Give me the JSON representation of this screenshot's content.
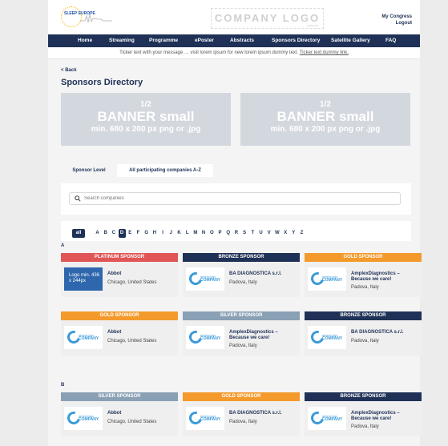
{
  "header": {
    "logo_text": "SLEEP EUROPE",
    "company_logo": "COMPANY LOGO",
    "company_logo_note": "optional",
    "account_links": [
      "My Congress",
      "Logout"
    ]
  },
  "nav": [
    "Home",
    "Streaming",
    "Programme",
    "ePoster",
    "Abstracts",
    "Sponsors Directory",
    "Satellite Gallery",
    "FAQ"
  ],
  "ticker": {
    "text": "Ticker text with your message … visit lorem ipsum  for new lorem ipsum dummy text.",
    "link": "Ticker text dummy link."
  },
  "back_label": "Back",
  "page_title": "Sponsors Directory",
  "banners": [
    {
      "line1": "1/2",
      "line2": "BANNER small",
      "line3": "min. 680 x 200 px png or .jpg"
    },
    {
      "line1": "1/2",
      "line2": "BANNER small",
      "line3": "min. 680 x 200 px png or .jpg"
    }
  ],
  "tabs": [
    "Sponsor Level",
    "All participating companies A-Z"
  ],
  "search": {
    "placeholder": "Search companies"
  },
  "alphabet": {
    "all_label": "all",
    "letters": [
      "A",
      "B",
      "C",
      "D",
      "E",
      "F",
      "G",
      "H",
      "I",
      "J",
      "K",
      "L",
      "M",
      "N",
      "O",
      "P",
      "Q",
      "R",
      "S",
      "T",
      "U",
      "V",
      "W",
      "X",
      "Y",
      "Z"
    ],
    "selected": "D"
  },
  "sections": [
    {
      "letter": "A",
      "cards": [
        {
          "level": "PLATINUM SPONSOR",
          "level_color": "#e05656",
          "name": "Abbot",
          "location": "Chicago, United States",
          "logo": "Logo min. 436 x 244px"
        },
        {
          "level": "BRONZE SPONSOR",
          "level_color": "#1f3157",
          "name": "BA DIAGNOSTICA s.r.l.",
          "location": "Padova, Italy",
          "logo": "generic"
        },
        {
          "level": "GOLD SPONSOR",
          "level_color": "#f49a2c",
          "name": "AmplexDiagnostics – Because we care!",
          "location": "Padova, Italy",
          "logo": "generic"
        },
        {
          "level": "GOLD SPONSOR",
          "level_color": "#f49a2c",
          "name": "Abbot",
          "location": "Chicago, United States",
          "logo": "generic"
        },
        {
          "level": "SILVER SPONSOR",
          "level_color": "#8aa0b4",
          "name": "AmplexDiagnostics – Because we care!",
          "location": "Padova, Italy",
          "logo": "generic"
        },
        {
          "level": "BRONZE SPONSOR",
          "level_color": "#1f3157",
          "name": "BA DIAGNOSTICA s.r.l.",
          "location": "Padova, Italy",
          "logo": "generic"
        }
      ]
    },
    {
      "letter": "B",
      "cards": [
        {
          "level": "SILVER SPONSOR",
          "level_color": "#8aa0b4",
          "name": "Abbot",
          "location": "Chicago, United States",
          "logo": "generic"
        },
        {
          "level": "GOLD SPONSOR",
          "level_color": "#f49a2c",
          "name": "BA DIAGNOSTICA s.r.l.",
          "location": "Padova, Italy",
          "logo": "generic"
        },
        {
          "level": "BRONZE SPONSOR",
          "level_color": "#1f3157",
          "name": "AmplexDiagnostics – Because we care!",
          "location": "Padova, Italy",
          "logo": "generic"
        }
      ]
    }
  ],
  "generic_logo": {
    "small": "generic logo",
    "big": "COMPANY"
  }
}
